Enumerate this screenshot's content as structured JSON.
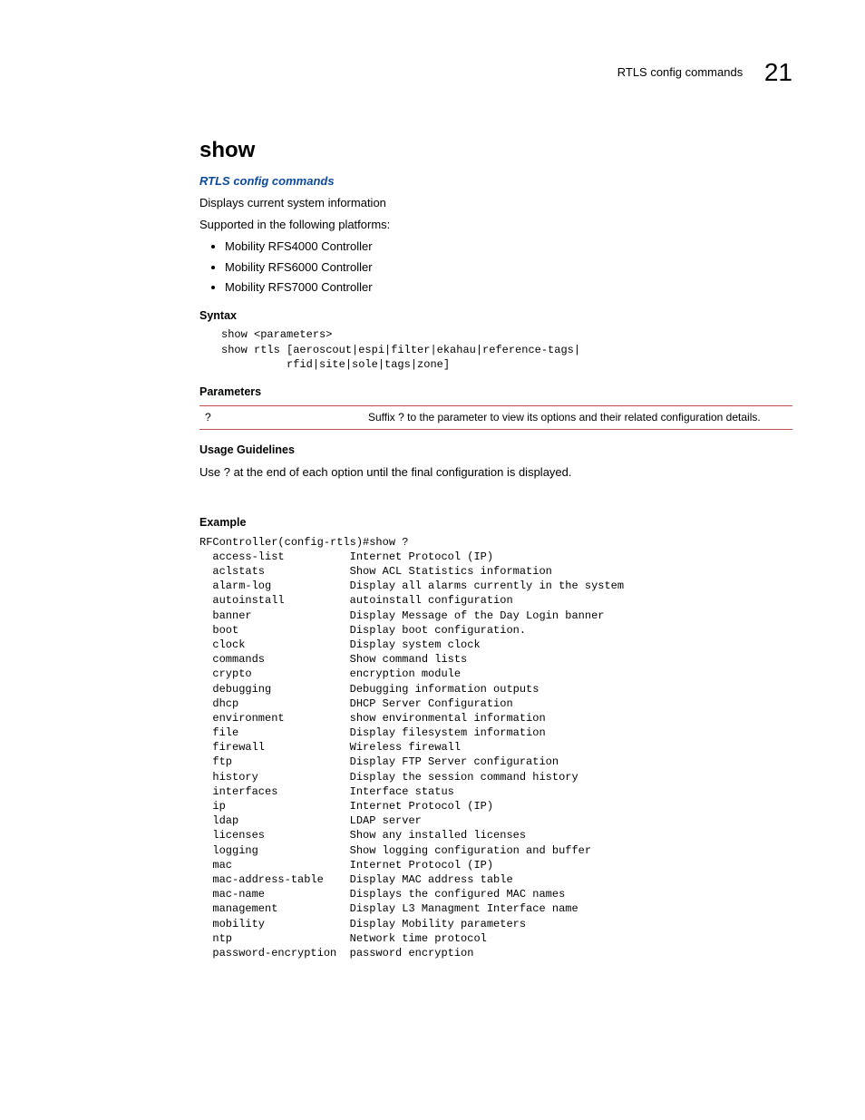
{
  "header": {
    "section": "RTLS config commands",
    "chapter": "21"
  },
  "title": "show",
  "breadcrumb": "RTLS config commands",
  "intro1": "Displays current system information",
  "intro2": "Supported in the following platforms:",
  "platforms": [
    "Mobility RFS4000 Controller",
    "Mobility RFS6000 Controller",
    "Mobility RFS7000 Controller"
  ],
  "sections": {
    "syntax_h": "Syntax",
    "syntax_code": "show <parameters>\nshow rtls [aeroscout|espi|filter|ekahau|reference-tags|\n          rfid|site|sole|tags|zone]",
    "parameters_h": "Parameters",
    "param_rows": [
      {
        "c1": "?",
        "c2": "Suffix ? to the parameter to view its options and their related configuration details."
      }
    ],
    "usage_h": "Usage Guidelines",
    "usage_text": "Use ? at the end of each option until the final configuration is displayed.",
    "example_h": "Example",
    "example_code": "RFController(config-rtls)#show ?\n  access-list          Internet Protocol (IP)\n  aclstats             Show ACL Statistics information\n  alarm-log            Display all alarms currently in the system\n  autoinstall          autoinstall configuration\n  banner               Display Message of the Day Login banner\n  boot                 Display boot configuration.\n  clock                Display system clock\n  commands             Show command lists\n  crypto               encryption module\n  debugging            Debugging information outputs\n  dhcp                 DHCP Server Configuration\n  environment          show environmental information\n  file                 Display filesystem information\n  firewall             Wireless firewall\n  ftp                  Display FTP Server configuration\n  history              Display the session command history\n  interfaces           Interface status\n  ip                   Internet Protocol (IP)\n  ldap                 LDAP server\n  licenses             Show any installed licenses\n  logging              Show logging configuration and buffer\n  mac                  Internet Protocol (IP)\n  mac-address-table    Display MAC address table\n  mac-name             Displays the configured MAC names\n  management           Display L3 Managment Interface name\n  mobility             Display Mobility parameters\n  ntp                  Network time protocol\n  password-encryption  password encryption"
  }
}
